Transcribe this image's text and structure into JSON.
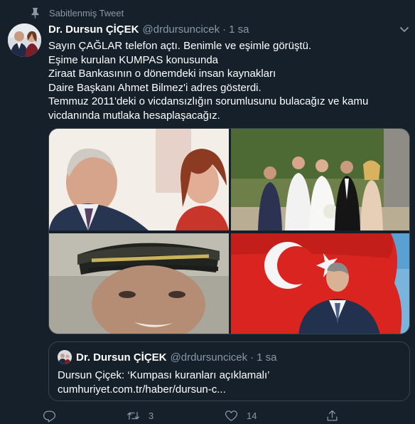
{
  "pinned": {
    "label": "Sabitlenmiş Tweet"
  },
  "tweet": {
    "author_name": "Dr. Dursun ÇİÇEK",
    "handle": "@drdursuncicek",
    "separator": "·",
    "time": "1 sa",
    "lines": [
      "Sayın ÇAĞLAR telefon açtı. Benimle ve eşimle görüştü.",
      "Eşime kurulan KUMPAS konusunda",
      "Ziraat Bankasının o dönemdeki insan kaynakları",
      "Daire Başkanı Ahmet Bilmez'i adres gösterdi.",
      "Temmuz 2011'deki o vicdansızlığın sorumlusunu bulacağız ve kamu",
      "vicdanında mutlaka hesaplaşacağız."
    ]
  },
  "quote": {
    "author_name": "Dr. Dursun ÇİÇEK",
    "handle": "@drdursuncicek",
    "separator": "·",
    "time": "1 sa",
    "text": "Dursun Çiçek: ‘Kumpası kuranları açıklamalı’ cumhuriyet.com.tr/haber/dursun-c..."
  },
  "actions": {
    "reply_count": "",
    "retweet_count": "3",
    "like_count": "14"
  },
  "icons": {
    "pin": "pin-icon",
    "chevron": "chevron-down-icon",
    "reply": "reply-icon",
    "retweet": "retweet-icon",
    "like": "heart-icon",
    "share": "share-icon"
  },
  "colors": {
    "background": "#15202b",
    "border": "#38444d",
    "secondary_text": "#8899a6",
    "primary_text": "#ffffff"
  }
}
